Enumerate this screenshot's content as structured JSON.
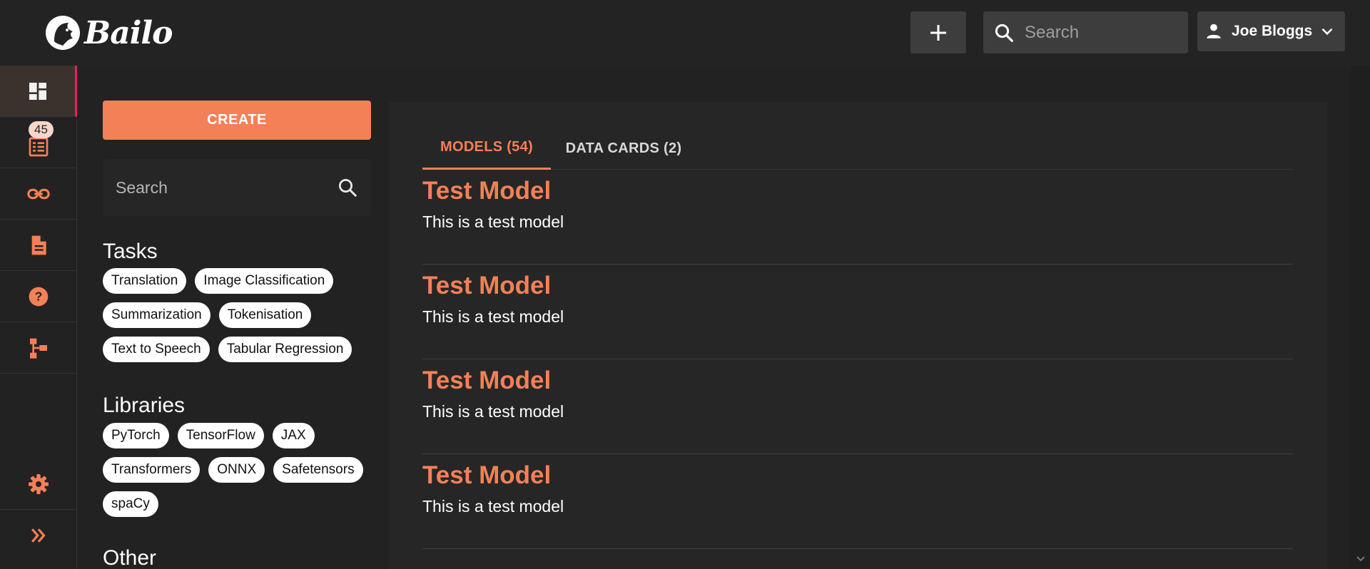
{
  "header": {
    "logo_text": "Bailo",
    "add_label": "+",
    "search_placeholder": "Search",
    "user_name": "Joe Bloggs"
  },
  "rail": {
    "items": [
      {
        "icon": "dashboard-icon",
        "active": true
      },
      {
        "icon": "review-list-icon",
        "badge": "45"
      },
      {
        "icon": "link-icon"
      },
      {
        "icon": "document-icon"
      },
      {
        "icon": "help-icon"
      },
      {
        "icon": "schema-icon"
      },
      {
        "icon": "settings-icon"
      },
      {
        "icon": "expand-icon"
      }
    ]
  },
  "filters": {
    "create_label": "CREATE",
    "search_placeholder": "Search",
    "tasks_title": "Tasks",
    "tasks": [
      "Translation",
      "Image Classification",
      "Summarization",
      "Tokenisation",
      "Text to Speech",
      "Tabular Regression"
    ],
    "libraries_title": "Libraries",
    "libraries": [
      "PyTorch",
      "TensorFlow",
      "JAX",
      "Transformers",
      "ONNX",
      "Safetensors",
      "spaCy"
    ],
    "other_title": "Other"
  },
  "tabs": [
    {
      "label": "MODELS (54)",
      "active": true
    },
    {
      "label": "DATA CARDS (2)",
      "active": false
    }
  ],
  "models": [
    {
      "title": "Test Model",
      "description": "This is a test model"
    },
    {
      "title": "Test Model",
      "description": "This is a test model"
    },
    {
      "title": "Test Model",
      "description": "This is a test model"
    },
    {
      "title": "Test Model",
      "description": "This is a test model"
    }
  ],
  "colors": {
    "accent": "#f48057",
    "background": "#222222",
    "panel": "#262626",
    "active_rail_marker": "#e91e63"
  }
}
